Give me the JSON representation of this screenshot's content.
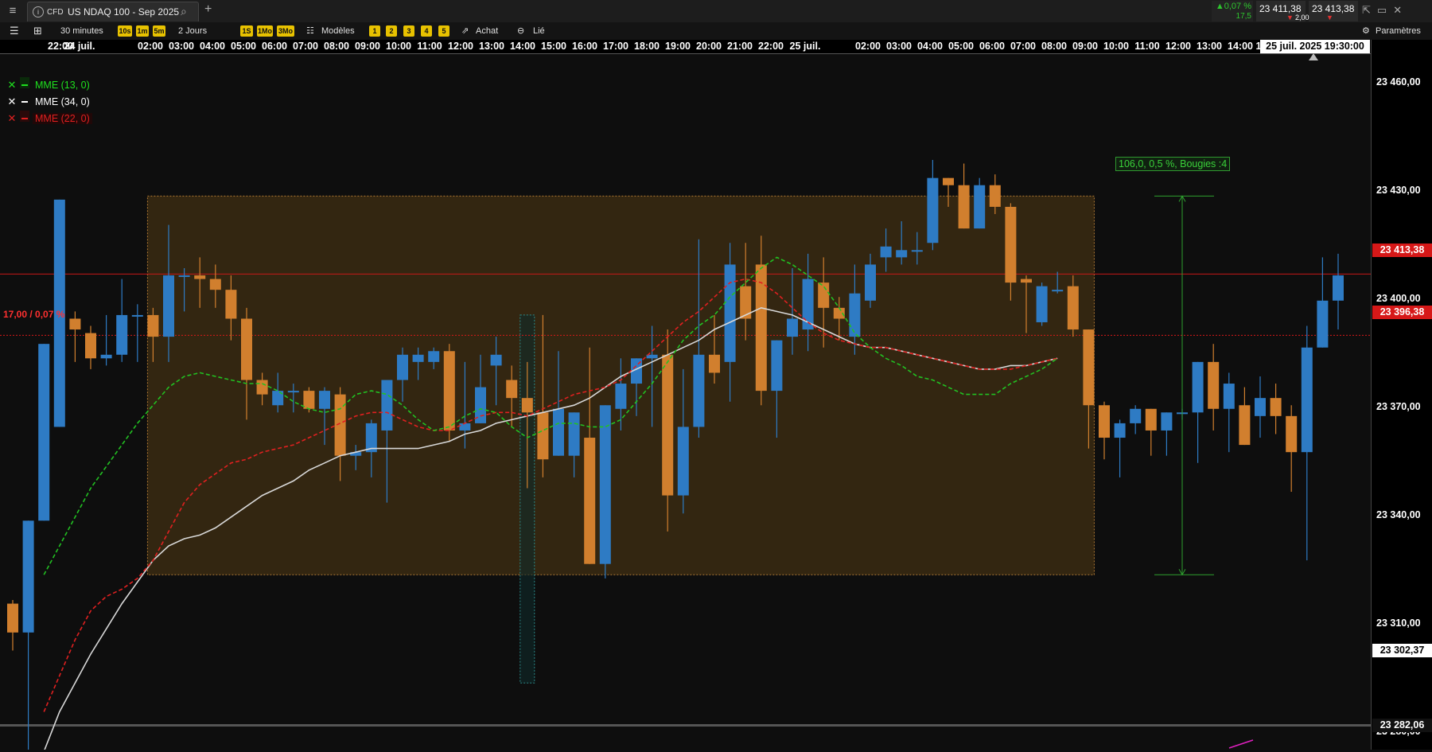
{
  "window": {
    "tab": {
      "info_icon": "i",
      "type": "CFD",
      "instrument": "US NDAQ 100 - Sep 2025"
    },
    "quote": {
      "change_pct": "0,07 %",
      "change_pts": "17,5",
      "bid": "23 411,38",
      "ask": "23 413,38",
      "spread": "2,00"
    }
  },
  "toolbar": {
    "timeframe": "30 minutes",
    "quick_timeframes": [
      "10s",
      "1m",
      "5m"
    ],
    "period": "2 Jours",
    "quick_periods": [
      "1S",
      "1Mo",
      "3Mo"
    ],
    "models_label": "Modèles",
    "model_slots": [
      "1",
      "2",
      "3",
      "4",
      "5"
    ],
    "buy_label": "Achat",
    "link_label": "Lié",
    "settings_label": "Paramètres"
  },
  "time_axis": {
    "labels": [
      "22:00",
      "24 juil.",
      "02:00",
      "03:00",
      "04:00",
      "05:00",
      "06:00",
      "07:00",
      "08:00",
      "09:00",
      "10:00",
      "11:00",
      "12:00",
      "13:00",
      "14:00",
      "15:00",
      "16:00",
      "17:00",
      "18:00",
      "19:00",
      "20:00",
      "21:00",
      "22:00",
      "25 juil.",
      "02:00",
      "03:00",
      "04:00",
      "05:00",
      "06:00",
      "07:00",
      "08:00",
      "09:00",
      "10:00",
      "11:00",
      "12:00",
      "13:00",
      "14:00",
      "1"
    ],
    "cursor_label": "25 juil. 2025 19:30:00"
  },
  "price_axis": {
    "ticks": [
      "23 460,00",
      "23 430,00",
      "23 400,00",
      "23 370,00",
      "23 340,00",
      "23 310,00",
      "23 280,00"
    ],
    "current_price": "23 413,38",
    "reference_price": "23 396,38",
    "range_low": "23 302,37",
    "lower_pane_value": "23 282,06"
  },
  "legend": [
    {
      "label": "MME (13, 0)",
      "color": "#22c022",
      "text_color": "#1ee01e"
    },
    {
      "label": "MME (34, 0)",
      "color": "#e8e8e8",
      "text_color": "#ffffff"
    },
    {
      "label": "MME (22, 0)",
      "color": "#e02020",
      "text_color": "#e02020"
    }
  ],
  "annotations": {
    "reference_line_label": "17,00 / 0,07 %",
    "measure_label": "106,0, 0,5 %, Bougies :4"
  },
  "colors": {
    "up_candle": "#2e7bc4",
    "down_candle": "#d17f2e",
    "ema13": "#22c022",
    "ema34": "#d8d8d8",
    "ema22": "#e02020",
    "zone_fill": "#3a2a12",
    "zone_border": "#b27a33",
    "measure": "#2fa02f",
    "highlight": "#2a8a8a"
  },
  "chart_data": {
    "type": "candlestick",
    "timeframe": "30 minutes",
    "ylim": [
      23277,
      23485
    ],
    "candles": [
      {
        "o": 23322,
        "h": 23323,
        "l": 23309,
        "c": 23314
      },
      {
        "o": 23314,
        "h": 23334,
        "l": 23270,
        "c": 23345
      },
      {
        "o": 23345,
        "h": 23386,
        "l": 23345,
        "c": 23394
      },
      {
        "o": 23371,
        "h": 23417,
        "l": 23371,
        "c": 23434
      },
      {
        "o": 23401,
        "h": 23403,
        "l": 23389,
        "c": 23398
      },
      {
        "o": 23397,
        "h": 23399,
        "l": 23387,
        "c": 23390
      },
      {
        "o": 23390,
        "h": 23402,
        "l": 23388,
        "c": 23391
      },
      {
        "o": 23391,
        "h": 23412,
        "l": 23389,
        "c": 23402
      },
      {
        "o": 23402,
        "h": 23405,
        "l": 23389,
        "c": 23402
      },
      {
        "o": 23402,
        "h": 23404,
        "l": 23389,
        "c": 23396
      },
      {
        "o": 23396,
        "h": 23427,
        "l": 23389,
        "c": 23413
      },
      {
        "o": 23413,
        "h": 23415,
        "l": 23403,
        "c": 23413
      },
      {
        "o": 23413,
        "h": 23418,
        "l": 23404,
        "c": 23412
      },
      {
        "o": 23412,
        "h": 23416,
        "l": 23404,
        "c": 23409
      },
      {
        "o": 23409,
        "h": 23413,
        "l": 23395,
        "c": 23401
      },
      {
        "o": 23401,
        "h": 23404,
        "l": 23373,
        "c": 23384
      },
      {
        "o": 23384,
        "h": 23386,
        "l": 23377,
        "c": 23380
      },
      {
        "o": 23377,
        "h": 23386,
        "l": 23375,
        "c": 23381
      },
      {
        "o": 23381,
        "h": 23383,
        "l": 23375,
        "c": 23381
      },
      {
        "o": 23381,
        "h": 23382,
        "l": 23375,
        "c": 23376
      },
      {
        "o": 23376,
        "h": 23382,
        "l": 23366,
        "c": 23381
      },
      {
        "o": 23380,
        "h": 23382,
        "l": 23356,
        "c": 23363
      },
      {
        "o": 23363,
        "h": 23366,
        "l": 23359,
        "c": 23364
      },
      {
        "o": 23364,
        "h": 23373,
        "l": 23357,
        "c": 23372
      },
      {
        "o": 23370,
        "h": 23380,
        "l": 23350,
        "c": 23384
      },
      {
        "o": 23384,
        "h": 23393,
        "l": 23378,
        "c": 23391
      },
      {
        "o": 23389,
        "h": 23393,
        "l": 23384,
        "c": 23391
      },
      {
        "o": 23389,
        "h": 23393,
        "l": 23387,
        "c": 23392
      },
      {
        "o": 23392,
        "h": 23394,
        "l": 23367,
        "c": 23370
      },
      {
        "o": 23370,
        "h": 23389,
        "l": 23365,
        "c": 23372
      },
      {
        "o": 23372,
        "h": 23391,
        "l": 23373,
        "c": 23382
      },
      {
        "o": 23388,
        "h": 23396,
        "l": 23377,
        "c": 23391
      },
      {
        "o": 23384,
        "h": 23388,
        "l": 23371,
        "c": 23379
      },
      {
        "o": 23379,
        "h": 23389,
        "l": 23354,
        "c": 23375
      },
      {
        "o": 23375,
        "h": 23402,
        "l": 23357,
        "c": 23362
      },
      {
        "o": 23363,
        "h": 23392,
        "l": 23366,
        "c": 23376
      },
      {
        "o": 23363,
        "h": 23374,
        "l": 23357,
        "c": 23375
      },
      {
        "o": 23368,
        "h": 23393,
        "l": 23358,
        "c": 23333
      },
      {
        "o": 23333,
        "h": 23374,
        "l": 23329,
        "c": 23377
      },
      {
        "o": 23376,
        "h": 23390,
        "l": 23370,
        "c": 23383
      },
      {
        "o": 23383,
        "h": 23390,
        "l": 23374,
        "c": 23390
      },
      {
        "o": 23390,
        "h": 23399,
        "l": 23371,
        "c": 23391
      },
      {
        "o": 23391,
        "h": 23398,
        "l": 23342,
        "c": 23352
      },
      {
        "o": 23352,
        "h": 23387,
        "l": 23347,
        "c": 23371
      },
      {
        "o": 23371,
        "h": 23423,
        "l": 23368,
        "c": 23391
      },
      {
        "o": 23391,
        "h": 23402,
        "l": 23383,
        "c": 23386
      },
      {
        "o": 23389,
        "h": 23422,
        "l": 23378,
        "c": 23416
      },
      {
        "o": 23410,
        "h": 23422,
        "l": 23395,
        "c": 23401
      },
      {
        "o": 23416,
        "h": 23424,
        "l": 23377,
        "c": 23381
      },
      {
        "o": 23381,
        "h": 23394,
        "l": 23368,
        "c": 23395
      },
      {
        "o": 23396,
        "h": 23415,
        "l": 23391,
        "c": 23401
      },
      {
        "o": 23398,
        "h": 23419,
        "l": 23392,
        "c": 23412
      },
      {
        "o": 23411,
        "h": 23418,
        "l": 23393,
        "c": 23404
      },
      {
        "o": 23404,
        "h": 23407,
        "l": 23395,
        "c": 23401
      },
      {
        "o": 23396,
        "h": 23416,
        "l": 23391,
        "c": 23408
      },
      {
        "o": 23406,
        "h": 23419,
        "l": 23404,
        "c": 23416
      },
      {
        "o": 23418,
        "h": 23426,
        "l": 23414,
        "c": 23421
      },
      {
        "o": 23418,
        "h": 23428,
        "l": 23416,
        "c": 23420
      },
      {
        "o": 23420,
        "h": 23425,
        "l": 23416,
        "c": 23420
      },
      {
        "o": 23422,
        "h": 23445,
        "l": 23420,
        "c": 23440
      },
      {
        "o": 23440,
        "h": 23438,
        "l": 23432,
        "c": 23438
      },
      {
        "o": 23438,
        "h": 23444,
        "l": 23426,
        "c": 23426
      },
      {
        "o": 23426,
        "h": 23440,
        "l": 23429,
        "c": 23438
      },
      {
        "o": 23438,
        "h": 23441,
        "l": 23430,
        "c": 23432
      },
      {
        "o": 23432,
        "h": 23433,
        "l": 23406,
        "c": 23411
      },
      {
        "o": 23412,
        "h": 23413,
        "l": 23397,
        "c": 23411
      },
      {
        "o": 23400,
        "h": 23411,
        "l": 23399,
        "c": 23410
      },
      {
        "o": 23409,
        "h": 23414,
        "l": 23408,
        "c": 23409
      },
      {
        "o": 23410,
        "h": 23413,
        "l": 23396,
        "c": 23398
      },
      {
        "o": 23398,
        "h": 23397,
        "l": 23365,
        "c": 23377
      },
      {
        "o": 23377,
        "h": 23378,
        "l": 23362,
        "c": 23368
      },
      {
        "o": 23368,
        "h": 23373,
        "l": 23357,
        "c": 23372
      },
      {
        "o": 23372,
        "h": 23377,
        "l": 23369,
        "c": 23376
      },
      {
        "o": 23376,
        "h": 23374,
        "l": 23363,
        "c": 23370
      },
      {
        "o": 23370,
        "h": 23374,
        "l": 23363,
        "c": 23375
      },
      {
        "o": 23375,
        "h": 23376,
        "l": 23373,
        "c": 23375
      },
      {
        "o": 23375,
        "h": 23382,
        "l": 23361,
        "c": 23389
      },
      {
        "o": 23389,
        "h": 23394,
        "l": 23370,
        "c": 23376
      },
      {
        "o": 23376,
        "h": 23386,
        "l": 23364,
        "c": 23383
      },
      {
        "o": 23377,
        "h": 23382,
        "l": 23366,
        "c": 23366
      },
      {
        "o": 23374,
        "h": 23385,
        "l": 23368,
        "c": 23379
      },
      {
        "o": 23379,
        "h": 23383,
        "l": 23369,
        "c": 23374
      },
      {
        "o": 23374,
        "h": 23377,
        "l": 23353,
        "c": 23364
      },
      {
        "o": 23364,
        "h": 23399,
        "l": 23334,
        "c": 23393
      },
      {
        "o": 23393,
        "h": 23418,
        "l": 23397,
        "c": 23406
      },
      {
        "o": 23406,
        "h": 23419,
        "l": 23398,
        "c": 23413
      }
    ],
    "ema13": [
      23330,
      23338,
      23346,
      23354,
      23360,
      23366,
      23372,
      23377,
      23382,
      23385,
      23386,
      23385,
      23384,
      23383,
      23383,
      23381,
      23378,
      23376,
      23375,
      23376,
      23380,
      23381,
      23380,
      23377,
      23373,
      23370,
      23371,
      23374,
      23376,
      23375,
      23371,
      23368,
      23370,
      23372,
      23372,
      23371,
      23371,
      23373,
      23378,
      23383,
      23389,
      23395,
      23399,
      23402,
      23407,
      23411,
      23415,
      23418,
      23416,
      23413,
      23410,
      23404,
      23397,
      23393,
      23390,
      23388,
      23385,
      23384,
      23382,
      23380,
      23380,
      23380,
      23383,
      23385,
      23387,
      23390
    ],
    "ema34": [
      23281,
      23292,
      23300,
      23308,
      23315,
      23322,
      23328,
      23334,
      23338,
      23340,
      23341,
      23343,
      23346,
      23349,
      23352,
      23354,
      23356,
      23359,
      23361,
      23363,
      23364,
      23365,
      23365,
      23365,
      23365,
      23366,
      23367,
      23369,
      23370,
      23372,
      23373,
      23374,
      23375,
      23376,
      23377,
      23379,
      23382,
      23385,
      23387,
      23389,
      23391,
      23393,
      23395,
      23398,
      23400,
      23402,
      23404,
      23403,
      23402,
      23400,
      23398,
      23396,
      23394,
      23393,
      23393,
      23392,
      23391,
      23390,
      23389,
      23388,
      23387,
      23387,
      23388,
      23388,
      23389,
      23390
    ],
    "ema22": [
      23292,
      23302,
      23312,
      23320,
      23324,
      23326,
      23329,
      23334,
      23342,
      23350,
      23355,
      23358,
      23361,
      23362,
      23364,
      23365,
      23366,
      23368,
      23370,
      23372,
      23374,
      23375,
      23375,
      23373,
      23371,
      23370,
      23370,
      23372,
      23374,
      23375,
      23375,
      23374,
      23376,
      23378,
      23380,
      23381,
      23382,
      23384,
      23388,
      23392,
      23396,
      23400,
      23403,
      23407,
      23411,
      23412,
      23411,
      23408,
      23404,
      23400,
      23397,
      23395,
      23394,
      23393,
      23393,
      23392,
      23391,
      23390,
      23389,
      23388,
      23387,
      23387,
      23387,
      23388,
      23389,
      23390
    ],
    "zone": {
      "from_candle": 9,
      "to_candle": 69,
      "price_high": 23435,
      "price_low": 23330
    },
    "highlight_candle": 33,
    "highlight_range": [
      23300,
      23402
    ],
    "measure": {
      "candle": 75,
      "from_price": 23330,
      "to_price": 23435,
      "text": "106,0, 0,5 %, Bougies :4"
    },
    "reference_price": 23396.38,
    "current_price": 23413.38
  }
}
